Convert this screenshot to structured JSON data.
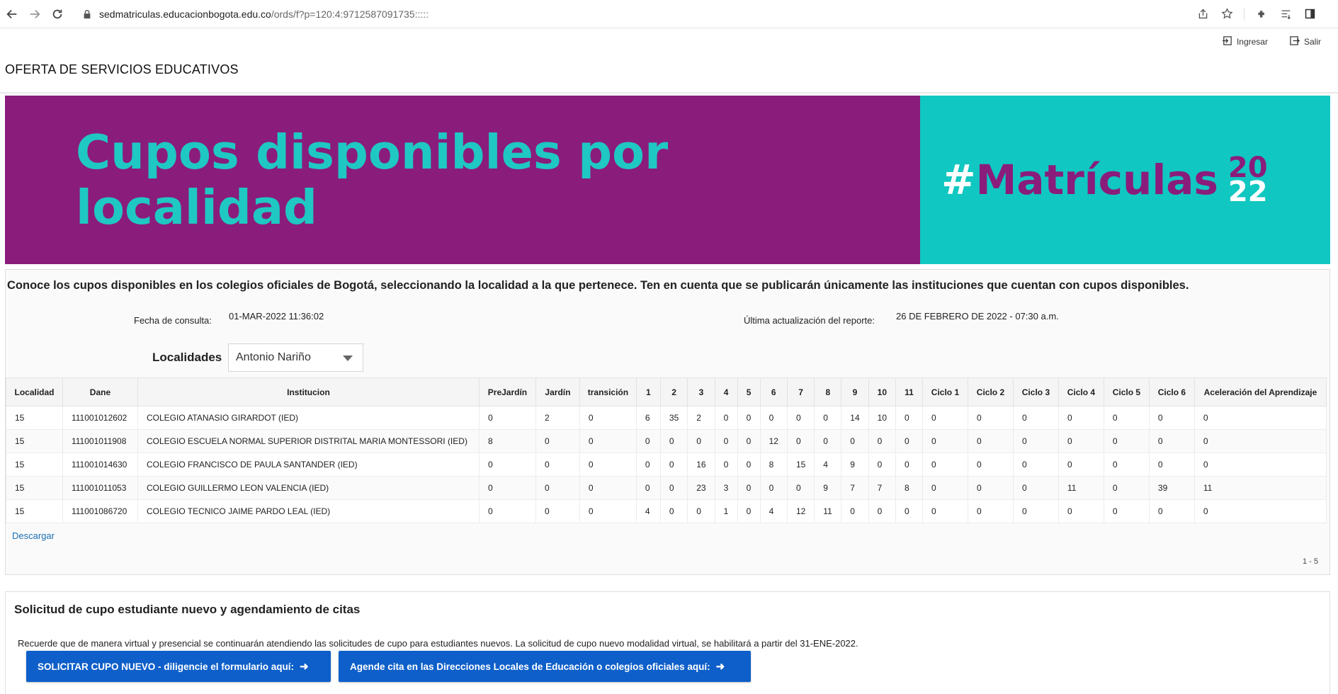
{
  "browser": {
    "url_domain": "sedmatriculas.educacionbogota.edu.co",
    "url_path": "/ords/f?p=120:4:9712587091735:::::"
  },
  "header": {
    "title": "OFERTA DE SERVICIOS EDUCATIVOS",
    "login_label": "Ingresar",
    "logout_label": "Salir"
  },
  "banner": {
    "left_text": "Cupos disponibles por localidad",
    "hashtag": "#",
    "campaign": "Matrículas",
    "year_top": "20",
    "year_bottom": "22",
    "colors": {
      "purple": "#8a1c7c",
      "teal": "#11c7c1"
    }
  },
  "report": {
    "intro": "Conoce los cupos disponibles en los colegios oficiales de Bogotá, seleccionando la localidad a la que pertenece. Ten en cuenta que se publicarán únicamente las instituciones que cuentan con cupos disponibles.",
    "query_date_label": "Fecha de consulta:",
    "query_date_value": "01-MAR-2022 11:36:02",
    "last_update_label": "Última actualización del reporte:",
    "last_update_value": "26 DE FEBRERO DE 2022 - 07:30 a.m.",
    "locality_label": "Localidades",
    "locality_selected": "Antonio Nariño",
    "columns": [
      "Localidad",
      "Dane",
      "Institucion",
      "PreJardín",
      "Jardín",
      "transición",
      "1",
      "2",
      "3",
      "4",
      "5",
      "6",
      "7",
      "8",
      "9",
      "10",
      "11",
      "Ciclo 1",
      "Ciclo 2",
      "Ciclo 3",
      "Ciclo 4",
      "Ciclo 5",
      "Ciclo 6",
      "Aceleración del Aprendizaje"
    ],
    "rows": [
      [
        "15",
        "111001012602",
        "COLEGIO ATANASIO GIRARDOT (IED)",
        "0",
        "2",
        "0",
        "6",
        "35",
        "2",
        "0",
        "0",
        "0",
        "0",
        "0",
        "14",
        "10",
        "0",
        "0",
        "0",
        "0",
        "0",
        "0",
        "0",
        "0"
      ],
      [
        "15",
        "111001011908",
        "COLEGIO ESCUELA NORMAL SUPERIOR DISTRITAL MARIA MONTESSORI (IED)",
        "8",
        "0",
        "0",
        "0",
        "0",
        "0",
        "0",
        "0",
        "12",
        "0",
        "0",
        "0",
        "0",
        "0",
        "0",
        "0",
        "0",
        "0",
        "0",
        "0",
        "0"
      ],
      [
        "15",
        "111001014630",
        "COLEGIO FRANCISCO DE PAULA SANTANDER (IED)",
        "0",
        "0",
        "0",
        "0",
        "0",
        "16",
        "0",
        "0",
        "8",
        "15",
        "4",
        "9",
        "0",
        "0",
        "0",
        "0",
        "0",
        "0",
        "0",
        "0",
        "0"
      ],
      [
        "15",
        "111001011053",
        "COLEGIO GUILLERMO LEON VALENCIA (IED)",
        "0",
        "0",
        "0",
        "0",
        "0",
        "23",
        "3",
        "0",
        "0",
        "0",
        "9",
        "7",
        "7",
        "8",
        "0",
        "0",
        "0",
        "11",
        "0",
        "39",
        "11"
      ],
      [
        "15",
        "111001086720",
        "COLEGIO TECNICO JAIME PARDO LEAL (IED)",
        "0",
        "0",
        "0",
        "4",
        "0",
        "0",
        "1",
        "0",
        "4",
        "12",
        "11",
        "0",
        "0",
        "0",
        "0",
        "0",
        "0",
        "0",
        "0",
        "0",
        "0"
      ]
    ],
    "download_label": "Descargar",
    "pagination": "1 - 5"
  },
  "appointments": {
    "title": "Solicitud de cupo estudiante nuevo y agendamiento de citas",
    "text": "Recuerde que de manera virtual y presencial se continuarán atendiendo las solicitudes de cupo para estudiantes nuevos. La solicitud de cupo nuevo modalidad virtual, se habilitará a partir del 31-ENE-2022.",
    "button_new": "SOLICITAR CUPO NUEVO - diligencie el formulario aquí:",
    "button_appointment": "Agende cita en las Direcciones Locales de Educación o colegios oficiales aquí:"
  }
}
